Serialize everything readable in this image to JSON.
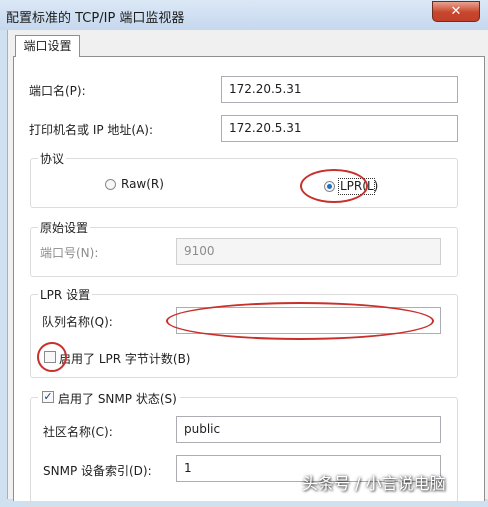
{
  "window": {
    "title": "配置标准的 TCP/IP 端口监视器",
    "close_glyph": "✕"
  },
  "tab": {
    "label": "端口设置"
  },
  "port_name": {
    "label": "端口名(P):",
    "value": "172.20.5.31"
  },
  "printer_address": {
    "label": "打印机名或 IP 地址(A):",
    "value": "172.20.5.31"
  },
  "protocol": {
    "group_label": "协议",
    "raw_label": "Raw(R)",
    "lpr_label": "LPR(L)",
    "selected": "LPR"
  },
  "raw_settings": {
    "group_label": "原始设置",
    "port_number_label": "端口号(N):",
    "port_number_value": "9100"
  },
  "lpr_settings": {
    "group_label": "LPR 设置",
    "queue_name_label": "队列名称(Q):",
    "queue_name_value": "",
    "byte_count_label": "启用了 LPR 字节计数(B)",
    "byte_count_checked": false
  },
  "snmp": {
    "enabled_label": "启用了 SNMP 状态(S)",
    "enabled_checked": true,
    "community_label": "社区名称(C):",
    "community_value": "public",
    "device_index_label": "SNMP 设备索引(D):",
    "device_index_value": "1"
  },
  "watermark": {
    "text": "头条号 / 小言说电脑"
  },
  "colors": {
    "annotation_circle": "#c8312b",
    "titlebar": "#cfe0f1",
    "close_button": "#c7462c"
  }
}
